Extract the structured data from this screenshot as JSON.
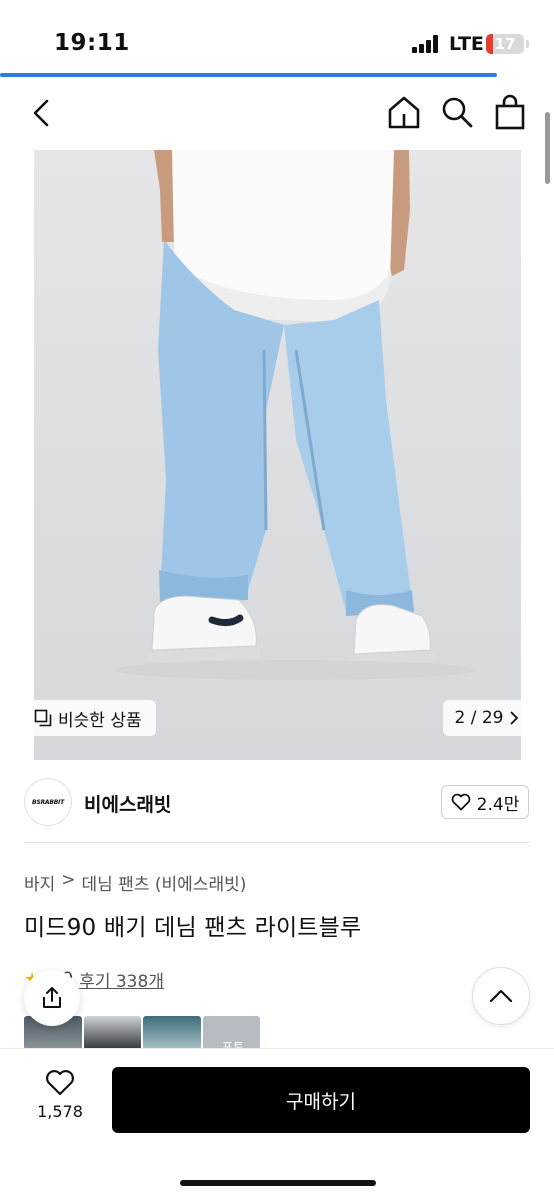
{
  "status_bar": {
    "time": "19:11",
    "network": "LTE",
    "battery": "17"
  },
  "colors": {
    "accent": "#2f7be0",
    "buy_button": "#000000",
    "battery_low": "#e63b2e",
    "rating_star": "#f5b301"
  },
  "icons": {
    "back": "chevron-left-icon",
    "home": "home-icon",
    "search": "search-icon",
    "cart": "shopping-bag-icon",
    "share": "share-icon",
    "scroll_top": "chevron-up-icon",
    "heart": "heart-icon"
  },
  "gallery": {
    "similar_label": "비슷한 상품",
    "pager": "2 / 29"
  },
  "brand": {
    "name": "비에스래빗",
    "logo_text": "BSRABBIT",
    "likes": "2.4만"
  },
  "breadcrumb": {
    "category": "바지",
    "separator": ">",
    "subcategory": "데님 팬츠 (비에스래빗)"
  },
  "product": {
    "title": "미드90 배기 데님 팬츠 라이트블루",
    "rating": "4.9",
    "review_label": "후기 338개",
    "thumb_badge": "포토"
  },
  "bottom_bar": {
    "wish_count": "1,578",
    "buy_label": "구매하기"
  }
}
